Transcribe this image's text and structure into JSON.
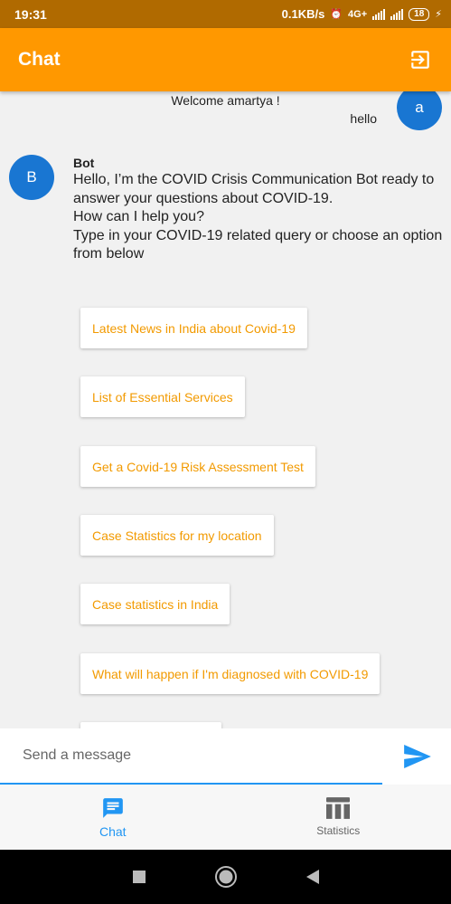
{
  "status_bar": {
    "time": "19:31",
    "net_speed": "0.1KB/s",
    "sim1": "4G+",
    "battery": "18"
  },
  "app_bar": {
    "title": "Chat"
  },
  "chat": {
    "welcome": "Welcome amartya !",
    "user_message": "hello",
    "user_avatar_letter": "a",
    "bot_avatar_letter": "B",
    "bot_name": "Bot",
    "bot_message": "Hello, I’m the COVID Crisis Communication Bot ready to answer your questions about COVID-19.\nHow can I help you?\nType in your COVID-19 related query or choose an option from below",
    "options": [
      "Latest News in India about Covid-19",
      "List of Essential Services",
      "Get a Covid-19 Risk Assessment Test",
      "Case Statistics for my location",
      "Case statistics in India",
      "What will happen if I'm diagnosed with COVID-19"
    ]
  },
  "input": {
    "placeholder": "Send a message"
  },
  "bottom_nav": {
    "chat_label": "Chat",
    "statistics_label": "Statistics"
  },
  "colors": {
    "accent": "#ff9800",
    "primary": "#2196f3"
  },
  "icons": [
    "logout-icon",
    "send-icon",
    "chat-icon",
    "statistics-icon",
    "square-icon",
    "home-circle-icon",
    "back-triangle-icon"
  ]
}
